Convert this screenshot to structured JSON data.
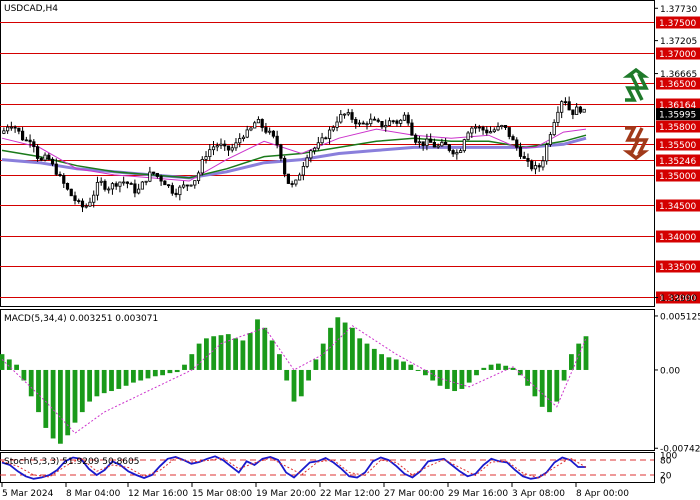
{
  "header": {
    "symbol_label": "USDCAD,H4",
    "macd_label": "MACD(5,34,4) 0.003251 0.003071",
    "stoch_label": "Stoch(5,3,3) 51.9209 50.8605"
  },
  "colors": {
    "level_line": "#d40000",
    "level_tag_bg": "#d40000",
    "current_tag_bg": "#000000",
    "ma_fast": "#cc33cc",
    "ma_mid": "#1a7a1a",
    "ma_slow": "#8a7fdc",
    "macd_hist": "#1a9a1a",
    "macd_signal": "#cc33cc",
    "stoch_main": "#1a1acc",
    "stoch_signal": "#dd3333",
    "arrow_up": "#1f7a2a",
    "arrow_down": "#a13a1a"
  },
  "icons": {
    "up_arrow": "zigzag-up-arrow-icon",
    "down_arrow": "zigzag-down-arrow-icon"
  },
  "chart_data": [
    {
      "type": "candlestick",
      "name": "price",
      "ylim": [
        1.329,
        1.378
      ],
      "price_ticks": [
        1.3773,
        1.372,
        1.3666,
        1.3299
      ],
      "levels": [
        1.375,
        1.37,
        1.365,
        1.3616,
        1.358,
        1.355,
        1.3524,
        1.35,
        1.345,
        1.34,
        1.335,
        1.33
      ],
      "level_labels": [
        "1.37500",
        "1.37000",
        "1.36500",
        "1.36164",
        "1.35800",
        "1.35500",
        "1.35246",
        "1.35000",
        "1.34500",
        "1.34000",
        "1.33500",
        "1.33000"
      ],
      "tick_labels": [
        "1.37730",
        "1.37205",
        "1.36665",
        "1.32990"
      ],
      "current_price": 1.35995,
      "current_label": "1.35995",
      "close_path": [
        [
          0,
          1.3568
        ],
        [
          4,
          1.3585
        ],
        [
          8,
          1.3575
        ],
        [
          12,
          1.3555
        ],
        [
          16,
          1.356
        ],
        [
          20,
          1.352
        ],
        [
          24,
          1.353
        ],
        [
          28,
          1.351
        ],
        [
          32,
          1.349
        ],
        [
          36,
          1.347
        ],
        [
          40,
          1.3455
        ],
        [
          44,
          1.3445
        ],
        [
          48,
          1.3462
        ],
        [
          52,
          1.349
        ],
        [
          56,
          1.3478
        ],
        [
          60,
          1.3485
        ],
        [
          64,
          1.349
        ],
        [
          68,
          1.3485
        ],
        [
          72,
          1.347
        ],
        [
          76,
          1.349
        ],
        [
          80,
          1.3505
        ],
        [
          84,
          1.3495
        ],
        [
          88,
          1.3485
        ],
        [
          92,
          1.347
        ],
        [
          96,
          1.348
        ],
        [
          100,
          1.3485
        ],
        [
          104,
          1.3495
        ],
        [
          108,
          1.353
        ],
        [
          112,
          1.3545
        ],
        [
          116,
          1.355
        ],
        [
          120,
          1.354
        ],
        [
          124,
          1.3545
        ],
        [
          128,
          1.3565
        ],
        [
          132,
          1.357
        ],
        [
          136,
          1.359
        ],
        [
          140,
          1.3575
        ],
        [
          144,
          1.3565
        ],
        [
          148,
          1.3545
        ],
        [
          152,
          1.349
        ],
        [
          156,
          1.348
        ],
        [
          160,
          1.351
        ],
        [
          164,
          1.354
        ],
        [
          168,
          1.3545
        ],
        [
          172,
          1.356
        ],
        [
          176,
          1.3575
        ],
        [
          180,
          1.3595
        ],
        [
          184,
          1.36
        ],
        [
          188,
          1.359
        ],
        [
          192,
          1.358
        ],
        [
          196,
          1.359
        ],
        [
          200,
          1.3585
        ],
        [
          204,
          1.358
        ],
        [
          208,
          1.359
        ],
        [
          212,
          1.3585
        ],
        [
          216,
          1.36
        ],
        [
          220,
          1.356
        ],
        [
          224,
          1.355
        ],
        [
          228,
          1.3555
        ],
        [
          232,
          1.3545
        ],
        [
          236,
          1.355
        ],
        [
          240,
          1.354
        ],
        [
          244,
          1.3535
        ],
        [
          248,
          1.357
        ],
        [
          252,
          1.358
        ],
        [
          256,
          1.3575
        ],
        [
          260,
          1.357
        ],
        [
          264,
          1.3575
        ],
        [
          268,
          1.358
        ],
        [
          272,
          1.356
        ],
        [
          276,
          1.354
        ],
        [
          280,
          1.352
        ],
        [
          284,
          1.351
        ],
        [
          288,
          1.3515
        ],
        [
          292,
          1.356
        ],
        [
          296,
          1.36
        ],
        [
          300,
          1.363
        ],
        [
          304,
          1.36
        ],
        [
          308,
          1.361
        ],
        [
          312,
          1.36
        ]
      ],
      "ma_fast": [
        [
          0,
          1.356
        ],
        [
          20,
          1.3545
        ],
        [
          40,
          1.351
        ],
        [
          60,
          1.35
        ],
        [
          80,
          1.3495
        ],
        [
          100,
          1.349
        ],
        [
          120,
          1.3525
        ],
        [
          140,
          1.3555
        ],
        [
          150,
          1.3545
        ],
        [
          160,
          1.3535
        ],
        [
          180,
          1.356
        ],
        [
          200,
          1.3575
        ],
        [
          220,
          1.3565
        ],
        [
          240,
          1.356
        ],
        [
          260,
          1.3565
        ],
        [
          275,
          1.3545
        ],
        [
          285,
          1.3545
        ],
        [
          300,
          1.357
        ],
        [
          312,
          1.3575
        ]
      ],
      "ma_mid": [
        [
          0,
          1.354
        ],
        [
          20,
          1.353
        ],
        [
          40,
          1.3515
        ],
        [
          60,
          1.3505
        ],
        [
          80,
          1.35
        ],
        [
          100,
          1.3495
        ],
        [
          120,
          1.351
        ],
        [
          140,
          1.353
        ],
        [
          160,
          1.3535
        ],
        [
          180,
          1.3545
        ],
        [
          200,
          1.3555
        ],
        [
          220,
          1.356
        ],
        [
          240,
          1.3555
        ],
        [
          260,
          1.3555
        ],
        [
          280,
          1.3545
        ],
        [
          300,
          1.3555
        ],
        [
          312,
          1.3565
        ]
      ],
      "ma_slow": [
        [
          0,
          1.3525
        ],
        [
          20,
          1.352
        ],
        [
          40,
          1.351
        ],
        [
          60,
          1.3505
        ],
        [
          80,
          1.35
        ],
        [
          100,
          1.3495
        ],
        [
          120,
          1.3505
        ],
        [
          140,
          1.352
        ],
        [
          160,
          1.3525
        ],
        [
          180,
          1.3535
        ],
        [
          200,
          1.354
        ],
        [
          220,
          1.3545
        ],
        [
          240,
          1.3545
        ],
        [
          260,
          1.3545
        ],
        [
          280,
          1.3545
        ],
        [
          300,
          1.355
        ],
        [
          312,
          1.356
        ]
      ]
    },
    {
      "type": "bar",
      "name": "macd",
      "ylim": [
        -0.0075,
        0.0055
      ],
      "tick_labels": [
        "0.005125",
        "0.00",
        "-0.007428"
      ],
      "ticks": [
        0.005125,
        0.0,
        -0.007428
      ],
      "histogram": [
        0.0015,
        0.001,
        0.0005,
        -0.001,
        -0.0025,
        -0.004,
        -0.0055,
        -0.0065,
        -0.007,
        -0.0062,
        -0.005,
        -0.004,
        -0.003,
        -0.0025,
        -0.0022,
        -0.002,
        -0.0018,
        -0.0015,
        -0.0012,
        -0.001,
        -0.0008,
        -0.0006,
        -0.0005,
        -0.0003,
        -0.0002,
        0.0005,
        0.0015,
        0.0025,
        0.003,
        0.0032,
        0.0033,
        0.0034,
        0.003,
        0.0028,
        0.0035,
        0.0048,
        0.004,
        0.0028,
        0.0015,
        -0.001,
        -0.003,
        -0.0025,
        -0.001,
        0.001,
        0.0025,
        0.004,
        0.005,
        0.0045,
        0.004,
        0.003,
        0.0025,
        0.002,
        0.0015,
        0.0012,
        0.001,
        0.0008,
        0.0005,
        0.0,
        -0.0005,
        -0.001,
        -0.0015,
        -0.0018,
        -0.002,
        -0.0018,
        -0.0012,
        -0.0005,
        0.0002,
        0.0005,
        0.0006,
        0.0004,
        0.0002,
        -0.0005,
        -0.0015,
        -0.0025,
        -0.0035,
        -0.004,
        -0.003,
        -0.001,
        0.0015,
        0.0025,
        0.0032
      ],
      "signal_path": [
        [
          0,
          0.001
        ],
        [
          6,
          -0.003
        ],
        [
          10,
          -0.006
        ],
        [
          14,
          -0.004
        ],
        [
          20,
          -0.002
        ],
        [
          26,
          0.0
        ],
        [
          30,
          0.0025
        ],
        [
          36,
          0.004
        ],
        [
          40,
          0.0
        ],
        [
          44,
          0.0015
        ],
        [
          48,
          0.0042
        ],
        [
          54,
          0.0015
        ],
        [
          60,
          -0.0008
        ],
        [
          64,
          -0.0016
        ],
        [
          70,
          0.0003
        ],
        [
          76,
          -0.0035
        ],
        [
          80,
          0.003
        ]
      ]
    },
    {
      "type": "line",
      "name": "stochastic",
      "ylim": [
        0,
        100
      ],
      "tick_labels": [
        "100",
        "80",
        "20",
        "0"
      ],
      "ticks": [
        100,
        80,
        20,
        0
      ],
      "levels": [
        80,
        20
      ],
      "main": [
        [
          0,
          70
        ],
        [
          4,
          60
        ],
        [
          8,
          35
        ],
        [
          12,
          15
        ],
        [
          16,
          5
        ],
        [
          20,
          10
        ],
        [
          24,
          20
        ],
        [
          28,
          40
        ],
        [
          32,
          75
        ],
        [
          36,
          90
        ],
        [
          40,
          85
        ],
        [
          44,
          45
        ],
        [
          48,
          20
        ],
        [
          52,
          40
        ],
        [
          56,
          75
        ],
        [
          60,
          60
        ],
        [
          64,
          35
        ],
        [
          68,
          20
        ],
        [
          72,
          8
        ],
        [
          76,
          20
        ],
        [
          80,
          55
        ],
        [
          84,
          85
        ],
        [
          88,
          92
        ],
        [
          92,
          80
        ],
        [
          96,
          65
        ],
        [
          100,
          72
        ],
        [
          104,
          85
        ],
        [
          108,
          95
        ],
        [
          112,
          80
        ],
        [
          116,
          55
        ],
        [
          120,
          30
        ],
        [
          124,
          75
        ],
        [
          128,
          60
        ],
        [
          132,
          85
        ],
        [
          136,
          92
        ],
        [
          140,
          80
        ],
        [
          144,
          30
        ],
        [
          148,
          10
        ],
        [
          152,
          40
        ],
        [
          156,
          70
        ],
        [
          160,
          75
        ],
        [
          164,
          88
        ],
        [
          168,
          70
        ],
        [
          172,
          45
        ],
        [
          176,
          15
        ],
        [
          180,
          10
        ],
        [
          184,
          30
        ],
        [
          188,
          75
        ],
        [
          192,
          90
        ],
        [
          196,
          80
        ],
        [
          200,
          55
        ],
        [
          204,
          25
        ],
        [
          208,
          10
        ],
        [
          212,
          35
        ],
        [
          216,
          75
        ],
        [
          220,
          80
        ],
        [
          224,
          85
        ],
        [
          228,
          60
        ],
        [
          232,
          35
        ],
        [
          236,
          15
        ],
        [
          240,
          25
        ],
        [
          244,
          60
        ],
        [
          248,
          85
        ],
        [
          252,
          75
        ],
        [
          256,
          70
        ],
        [
          260,
          40
        ],
        [
          264,
          15
        ],
        [
          268,
          5
        ],
        [
          272,
          10
        ],
        [
          276,
          30
        ],
        [
          280,
          70
        ],
        [
          284,
          90
        ],
        [
          288,
          80
        ],
        [
          292,
          52
        ],
        [
          296,
          52
        ]
      ],
      "signal": [
        [
          0,
          75
        ],
        [
          8,
          55
        ],
        [
          16,
          20
        ],
        [
          24,
          12
        ],
        [
          32,
          55
        ],
        [
          40,
          88
        ],
        [
          48,
          35
        ],
        [
          56,
          60
        ],
        [
          64,
          50
        ],
        [
          72,
          15
        ],
        [
          80,
          38
        ],
        [
          88,
          88
        ],
        [
          96,
          72
        ],
        [
          104,
          78
        ],
        [
          112,
          88
        ],
        [
          120,
          45
        ],
        [
          128,
          68
        ],
        [
          136,
          88
        ],
        [
          144,
          55
        ],
        [
          152,
          22
        ],
        [
          160,
          72
        ],
        [
          168,
          80
        ],
        [
          176,
          30
        ],
        [
          184,
          18
        ],
        [
          192,
          80
        ],
        [
          200,
          70
        ],
        [
          208,
          20
        ],
        [
          216,
          55
        ],
        [
          224,
          82
        ],
        [
          232,
          50
        ],
        [
          240,
          18
        ],
        [
          248,
          72
        ],
        [
          256,
          75
        ],
        [
          264,
          28
        ],
        [
          272,
          8
        ],
        [
          280,
          50
        ],
        [
          288,
          88
        ],
        [
          296,
          51
        ]
      ]
    }
  ],
  "x_axis": {
    "labels": [
      "5 Mar 2024",
      "8 Mar 04:00",
      "12 Mar 16:00",
      "15 Mar 08:00",
      "19 Mar 20:00",
      "22 Mar 12:00",
      "27 Mar 00:00",
      "29 Mar 16:00",
      "3 Apr 08:00",
      "8 Apr 00:00"
    ]
  }
}
